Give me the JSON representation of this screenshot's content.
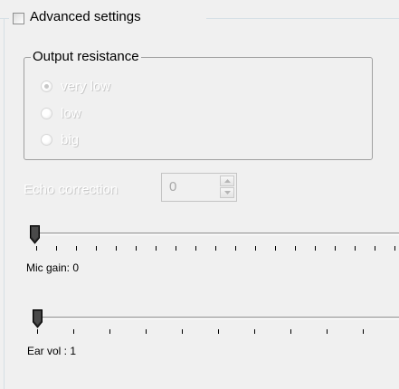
{
  "advanced": {
    "label": "Advanced settings",
    "checked": false
  },
  "output_resistance": {
    "title": "Output resistance",
    "options": [
      {
        "label": "very low",
        "checked": true
      },
      {
        "label": "low",
        "checked": false
      },
      {
        "label": "big",
        "checked": false
      }
    ]
  },
  "echo": {
    "label": "Echo correction",
    "value": "0"
  },
  "mic_gain": {
    "label": "Mic gain: 0",
    "value": 0
  },
  "ear_vol": {
    "label": "Ear vol : 1",
    "value": 1
  },
  "icons": [
    "chevron-up-icon",
    "chevron-down-icon",
    "slider-thumb-icon"
  ]
}
